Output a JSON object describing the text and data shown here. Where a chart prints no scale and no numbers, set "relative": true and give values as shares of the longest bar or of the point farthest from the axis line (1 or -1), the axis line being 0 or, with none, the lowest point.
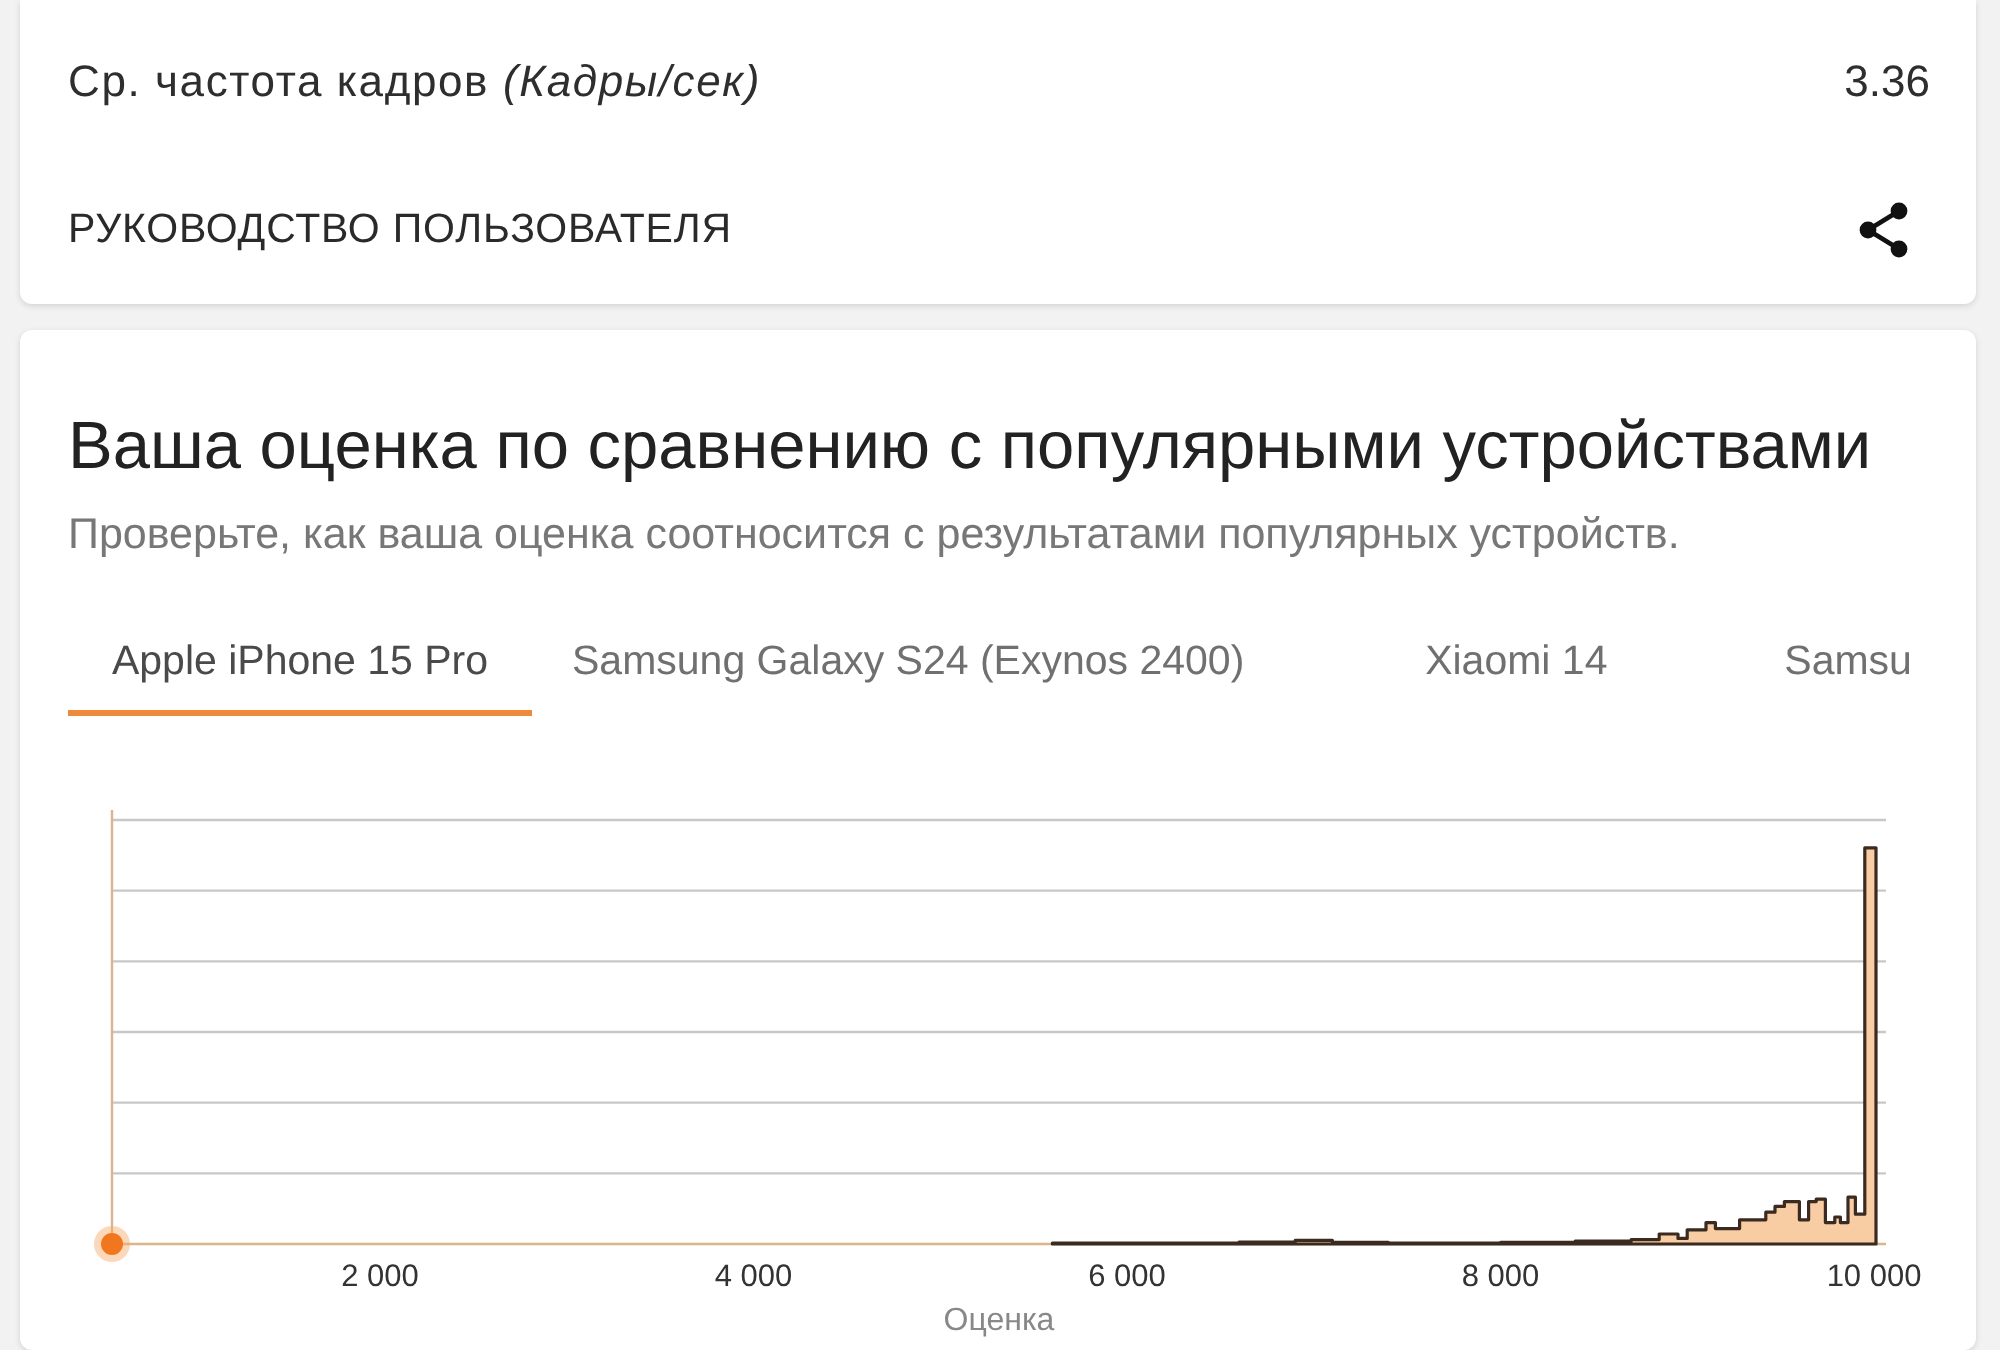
{
  "stats_card": {
    "rows": [
      {
        "label": "Ср. частота кадров *(Кадры/сек)*",
        "value": "3.36"
      }
    ],
    "user_guide": {
      "label": "РУКОВОДСТВО ПОЛЬЗОВАТЕЛЯ"
    }
  },
  "comparison": {
    "title": "Ваша оценка по сравнению с популярными устройствами",
    "subtitle": "Проверьте, как ваша оценка соотносится с результатами популярных устройств.",
    "tabs": [
      {
        "label": "Apple iPhone 15 Pro",
        "selected": true
      },
      {
        "label": "Samsung Galaxy S24 (Exynos 2400)",
        "selected": false
      },
      {
        "label": "Xiaomi 14",
        "selected": false
      },
      {
        "label": "Samsu",
        "selected": false
      }
    ],
    "chart_data": {
      "type": "area",
      "relative": true,
      "xlabel": "Оценка",
      "x": [
        5600,
        6000,
        6600,
        6900,
        7100,
        7400,
        8000,
        8400,
        8700,
        8850,
        8950,
        9000,
        9100,
        9150,
        9280,
        9420,
        9470,
        9520,
        9600,
        9650,
        9690,
        9740,
        9790,
        9820,
        9860,
        9900,
        9950,
        10010
      ],
      "series": [
        {
          "color": "#f9cda4",
          "values": [
            0.002,
            0.002,
            0.005,
            0.009,
            0.004,
            0.002,
            0.004,
            0.007,
            0.011,
            0.025,
            0.014,
            0.036,
            0.054,
            0.039,
            0.061,
            0.08,
            0.095,
            0.107,
            0.061,
            0.107,
            0.113,
            0.054,
            0.068,
            0.054,
            0.118,
            0.075,
            1,
            0
          ]
        }
      ],
      "xlim": [
        565,
        10064
      ],
      "xticks": [
        {
          "value": 2000,
          "label": "2 000"
        },
        {
          "value": 4000,
          "label": "4 000"
        },
        {
          "value": 6000,
          "label": "6 000"
        },
        {
          "value": 8000,
          "label": "8 000"
        },
        {
          "value": 10000,
          "label": "10 000"
        }
      ]
    }
  }
}
